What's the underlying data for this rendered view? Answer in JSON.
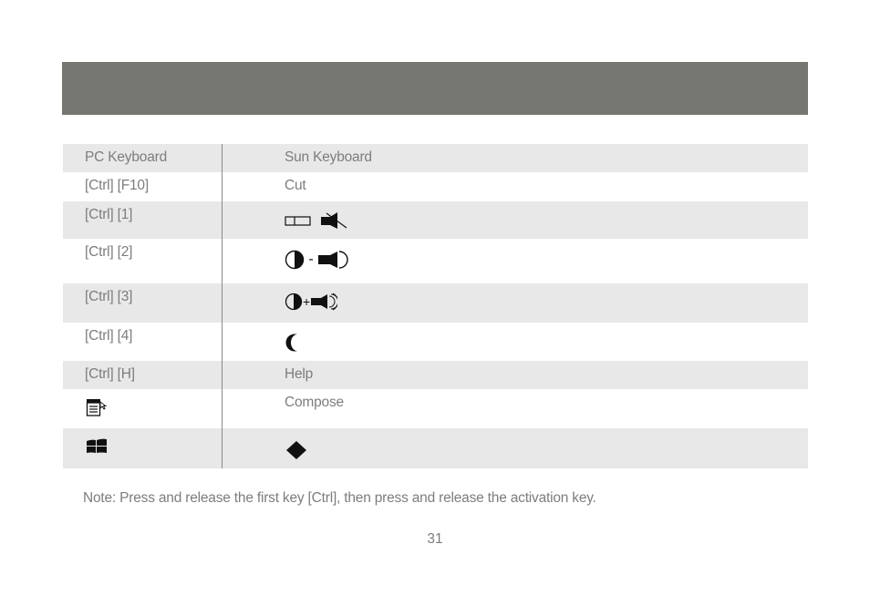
{
  "table": {
    "headers": {
      "pc": "PC Keyboard",
      "sun": "Sun Keyboard"
    },
    "rows": [
      {
        "pc": "[Ctrl] [F10]",
        "sun": "Cut"
      },
      {
        "pc": "[Ctrl] [1]",
        "sun_icons": [
          "display-off-icon",
          "speaker-mute-icon"
        ]
      },
      {
        "pc": "[Ctrl] [2]",
        "sun_icons": [
          "brightness-icon",
          "minus",
          "volume-down-icon"
        ]
      },
      {
        "pc": "[Ctrl] [3]",
        "sun_icons": [
          "brightness-icon",
          "plus",
          "volume-up-icon"
        ]
      },
      {
        "pc": "[Ctrl] [4]",
        "sun_icons": [
          "sleep-moon-icon"
        ]
      },
      {
        "pc": "[Ctrl] [H]",
        "sun": "Help"
      },
      {
        "pc_icon": "menu-key-icon",
        "sun": "Compose"
      },
      {
        "pc_icon": "windows-key-icon",
        "sun_icons": [
          "meta-diamond-icon"
        ]
      }
    ]
  },
  "symbols": {
    "minus": "-",
    "plus": "+"
  },
  "note": "Note: Press and release the first key [Ctrl], then press and release the activation key.",
  "page_number": "31"
}
